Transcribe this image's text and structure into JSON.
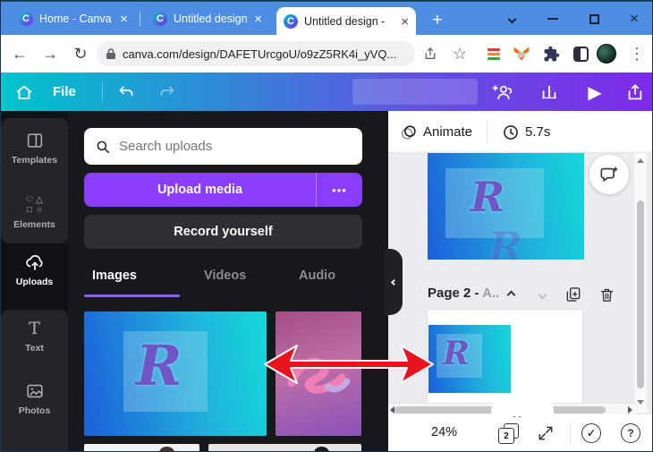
{
  "browser": {
    "tabs": [
      {
        "title": "Home - Canva"
      },
      {
        "title": "Untitled design -"
      },
      {
        "title": "Untitled design -"
      }
    ],
    "url": "canva.com/design/DAFETUrcgoU/o9zZ5RK4i_yVQ..."
  },
  "toolbar": {
    "file_label": "File"
  },
  "sidebar": {
    "items": [
      {
        "label": "Templates"
      },
      {
        "label": "Elements"
      },
      {
        "label": "Uploads"
      },
      {
        "label": "Text"
      },
      {
        "label": "Photos"
      }
    ]
  },
  "uploads_panel": {
    "search_placeholder": "Search uploads",
    "upload_button_label": "Upload media",
    "record_button_label": "Record yourself",
    "tabs": [
      {
        "label": "Images"
      },
      {
        "label": "Videos"
      },
      {
        "label": "Audio"
      }
    ]
  },
  "canvas": {
    "animate_label": "Animate",
    "duration_label": "5.7s",
    "page2_title": "Page 2 -",
    "page2_placeholder": "A..",
    "logo_letter": "R"
  },
  "statusbar": {
    "zoom_level": "24%",
    "page_count": "2"
  },
  "glyphs": {
    "canva_c": "C",
    "close": "×",
    "plus": "+",
    "back": "←",
    "forward": "→",
    "reload": "↻",
    "star": "☆",
    "menu_dots": "⋮",
    "more_dots": "•••",
    "play": "▶",
    "text_tool": "T",
    "check": "✓",
    "question": "?",
    "elements_heart": "♡",
    "elements_triangle": "△",
    "elements_square": "□",
    "elements_circle": "○"
  },
  "colors": {
    "tab_bar": "#4D8EE2",
    "toolbar_gradient_start": "#00C4CC",
    "toolbar_gradient_end": "#7D2AE8",
    "accent_purple": "#8B3DFF",
    "images_underline": "#8A5CF6",
    "arrow_red": "#E9131D",
    "canvas_bg": "#EBECEF"
  }
}
